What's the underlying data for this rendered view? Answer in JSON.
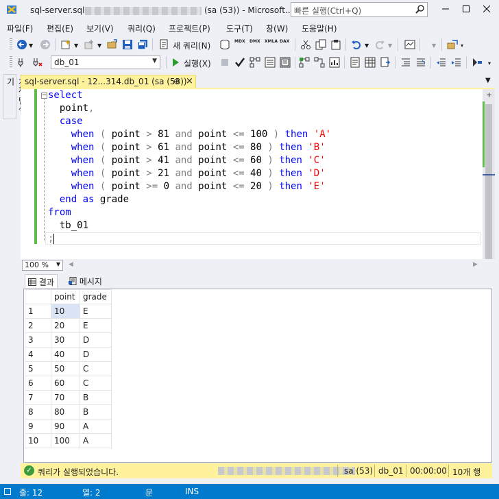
{
  "window": {
    "title_file": "sql-server.sql -",
    "title_session": "(sa (53)) - Microsoft...",
    "quick_launch_placeholder": "빠른 실행(Ctrl+Q)"
  },
  "menu": [
    "파일(F)",
    "편집(E)",
    "보기(V)",
    "쿼리(Q)",
    "프로젝트(P)",
    "도구(T)",
    "창(W)",
    "도움말(H)"
  ],
  "toolbar": {
    "new_query": "새 쿼리(N)",
    "database": "db_01",
    "execute": "실행(X)",
    "mdx": "MDX",
    "dmx": "DMX",
    "xmla": "XMLA",
    "dax": "DAX"
  },
  "side_tab": "개체 탐색기",
  "doc_tab": {
    "title": "sql-server.sql - 12...314.db_01 (sa (53))",
    "pin": "⊕",
    "close": "×"
  },
  "editor": {
    "lines": [
      [
        [
          "kw",
          "select"
        ]
      ],
      [
        [
          "id",
          "  point"
        ],
        [
          "op",
          ","
        ]
      ],
      [
        [
          "kw",
          "  case"
        ]
      ],
      [
        [
          "kw",
          "    when "
        ],
        [
          "op",
          "( "
        ],
        [
          "id",
          "point "
        ],
        [
          "op",
          "> "
        ],
        [
          "id",
          "81 "
        ],
        [
          "op",
          "and "
        ],
        [
          "id",
          "point "
        ],
        [
          "op",
          "<= "
        ],
        [
          "id",
          "100 "
        ],
        [
          "op",
          ") "
        ],
        [
          "kw",
          "then "
        ],
        [
          "str",
          "'A'"
        ]
      ],
      [
        [
          "kw",
          "    when "
        ],
        [
          "op",
          "( "
        ],
        [
          "id",
          "point "
        ],
        [
          "op",
          "> "
        ],
        [
          "id",
          "61 "
        ],
        [
          "op",
          "and "
        ],
        [
          "id",
          "point "
        ],
        [
          "op",
          "<= "
        ],
        [
          "id",
          "80 "
        ],
        [
          "op",
          ") "
        ],
        [
          "kw",
          "then "
        ],
        [
          "str",
          "'B'"
        ]
      ],
      [
        [
          "kw",
          "    when "
        ],
        [
          "op",
          "( "
        ],
        [
          "id",
          "point "
        ],
        [
          "op",
          "> "
        ],
        [
          "id",
          "41 "
        ],
        [
          "op",
          "and "
        ],
        [
          "id",
          "point "
        ],
        [
          "op",
          "<= "
        ],
        [
          "id",
          "60 "
        ],
        [
          "op",
          ") "
        ],
        [
          "kw",
          "then "
        ],
        [
          "str",
          "'C'"
        ]
      ],
      [
        [
          "kw",
          "    when "
        ],
        [
          "op",
          "( "
        ],
        [
          "id",
          "point "
        ],
        [
          "op",
          "> "
        ],
        [
          "id",
          "21 "
        ],
        [
          "op",
          "and "
        ],
        [
          "id",
          "point "
        ],
        [
          "op",
          "<= "
        ],
        [
          "id",
          "40 "
        ],
        [
          "op",
          ") "
        ],
        [
          "kw",
          "then "
        ],
        [
          "str",
          "'D'"
        ]
      ],
      [
        [
          "kw",
          "    when "
        ],
        [
          "op",
          "( "
        ],
        [
          "id",
          "point "
        ],
        [
          "op",
          ">= "
        ],
        [
          "id",
          "0 "
        ],
        [
          "op",
          "and "
        ],
        [
          "id",
          "point "
        ],
        [
          "op",
          "<= "
        ],
        [
          "id",
          "20 "
        ],
        [
          "op",
          ") "
        ],
        [
          "kw",
          "then "
        ],
        [
          "str",
          "'E'"
        ]
      ],
      [
        [
          "kw",
          "  end as "
        ],
        [
          "id",
          "grade"
        ]
      ],
      [
        [
          "kw",
          "from"
        ]
      ],
      [
        [
          "id",
          "  tb_01"
        ]
      ],
      [
        [
          "op",
          ";"
        ]
      ]
    ]
  },
  "zoom": "100 %",
  "result_tabs": {
    "results": "결과",
    "messages": "메시지"
  },
  "grid": {
    "columns": [
      "point",
      "grade"
    ],
    "rows": [
      [
        "1",
        "10",
        "E"
      ],
      [
        "2",
        "20",
        "E"
      ],
      [
        "3",
        "30",
        "D"
      ],
      [
        "4",
        "40",
        "D"
      ],
      [
        "5",
        "50",
        "C"
      ],
      [
        "6",
        "60",
        "C"
      ],
      [
        "7",
        "70",
        "B"
      ],
      [
        "8",
        "80",
        "B"
      ],
      [
        "9",
        "90",
        "A"
      ],
      [
        "10",
        "100",
        "A"
      ]
    ]
  },
  "query_status": {
    "message": "쿼리가 실행되었습니다.",
    "login": "sa (53)",
    "database": "db_01",
    "elapsed": "00:00:00",
    "row_count": "10개 행"
  },
  "statusbar": {
    "line": "줄: 12",
    "col": "열: 2",
    "char": "문",
    "mode": "INS"
  },
  "colors": {
    "accent": "#007acc",
    "tab_active": "#fff29d",
    "keyword": "#0000ff",
    "string": "#ff0000",
    "operator": "#808080",
    "change_bar": "#5fbe49"
  }
}
